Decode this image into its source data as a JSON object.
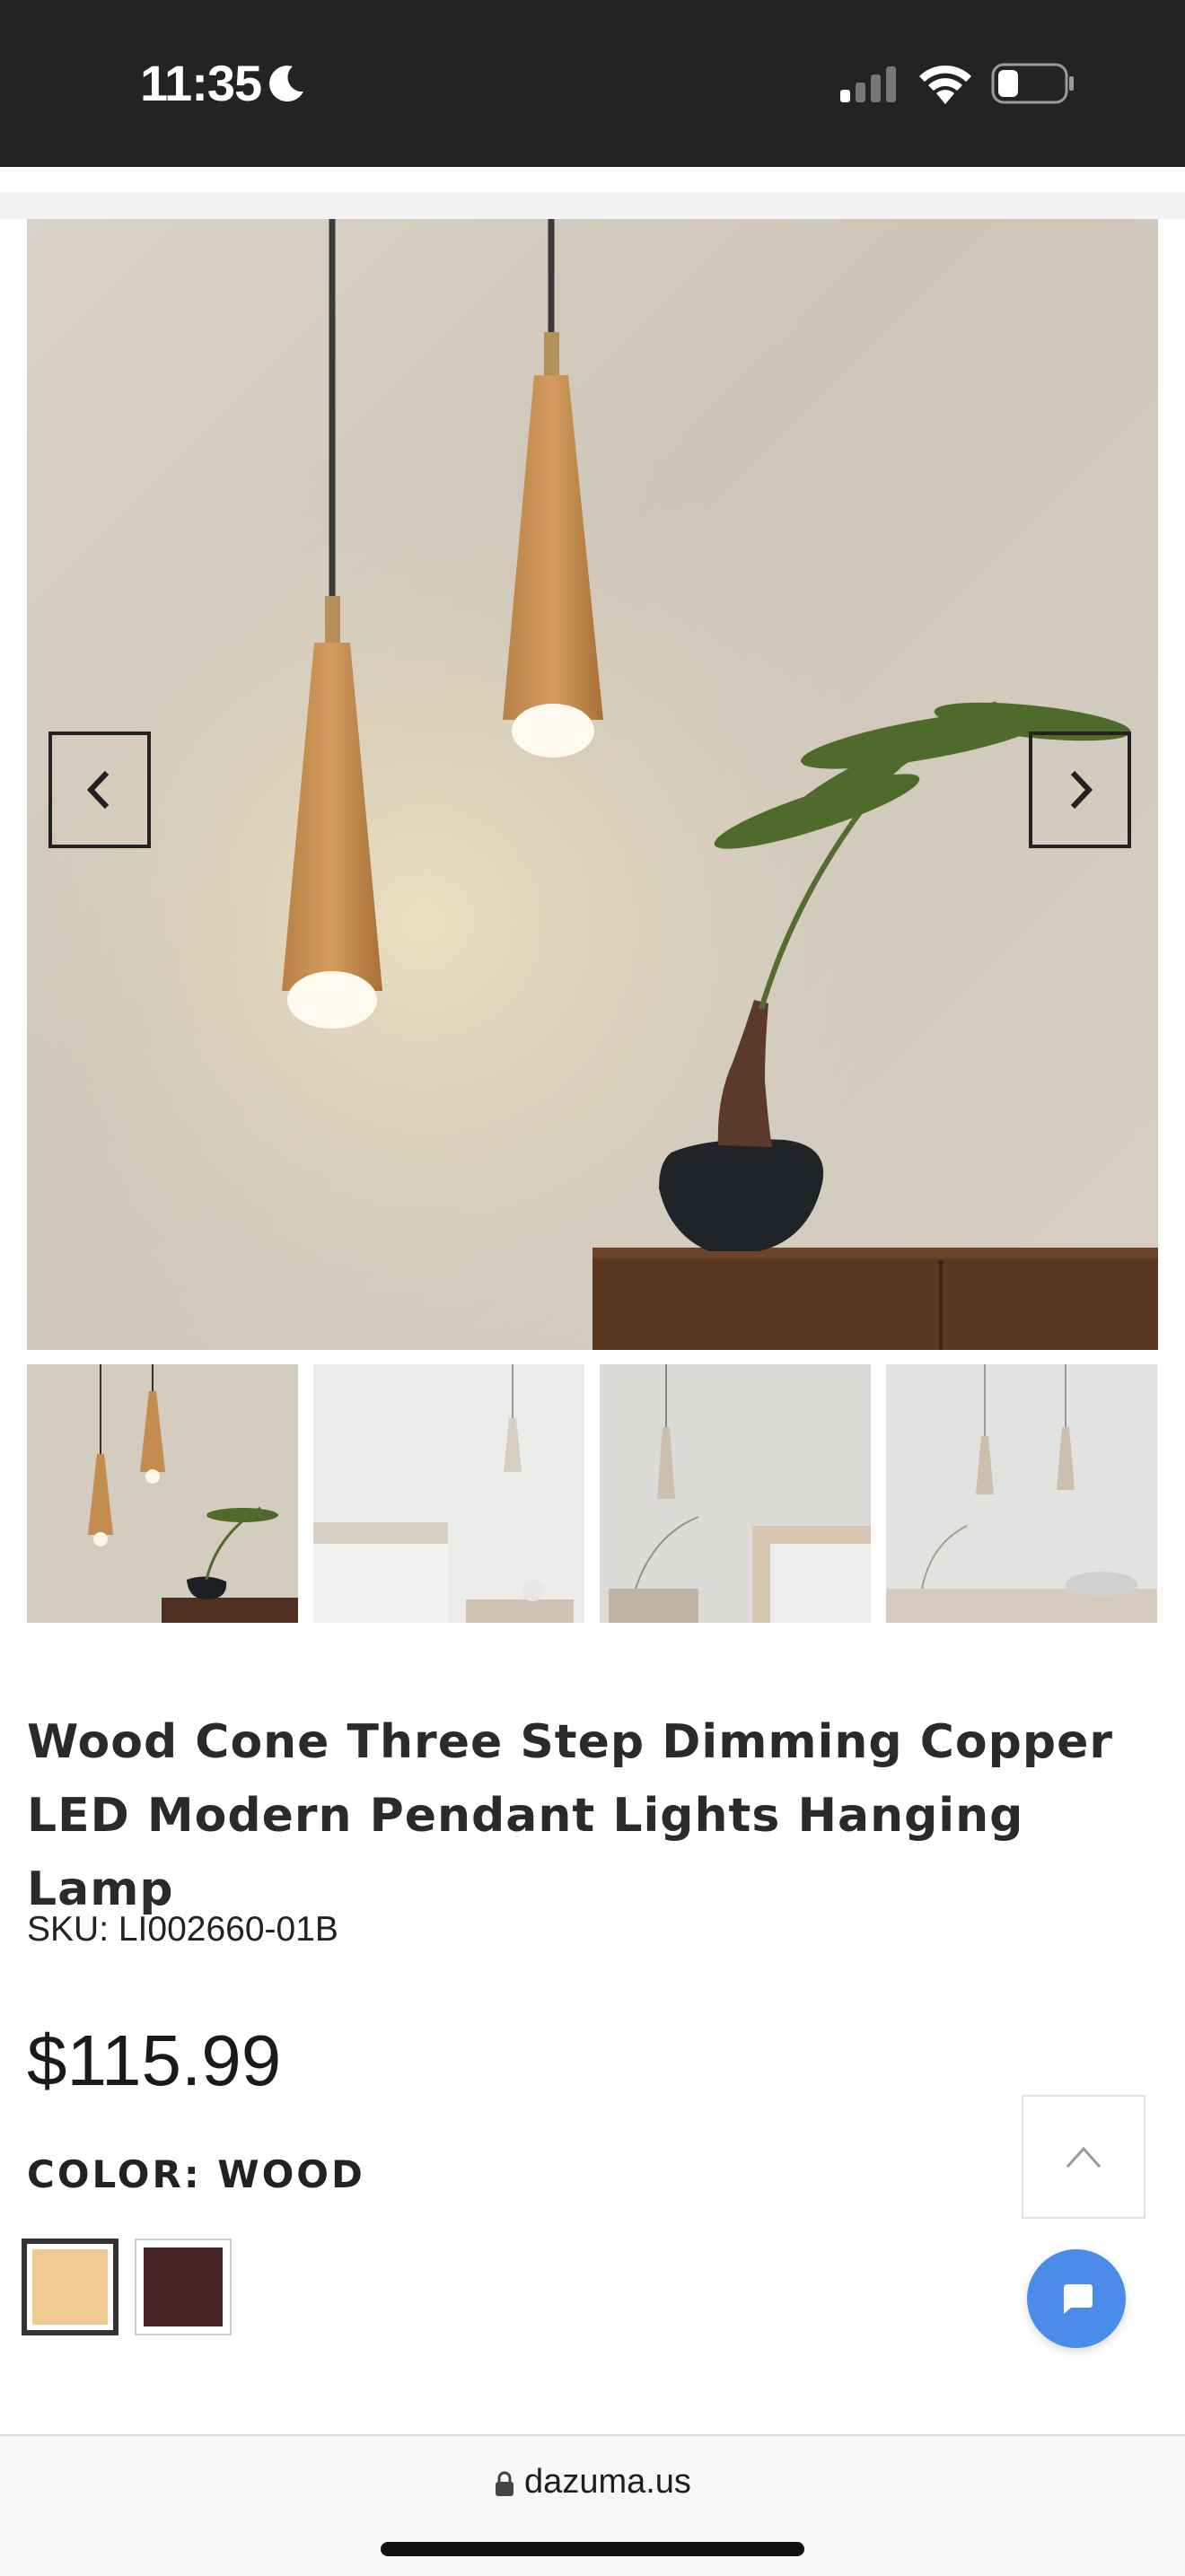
{
  "status_bar": {
    "time": "11:35",
    "moon_icon": "moon-icon",
    "signal_icon": "cellular-signal-icon",
    "wifi_icon": "wifi-icon",
    "battery_icon": "battery-icon"
  },
  "gallery": {
    "prev_icon": "chevron-left-icon",
    "next_icon": "chevron-right-icon",
    "thumbnail_count": 4
  },
  "product": {
    "title": "Wood Cone Three Step Dimming Copper LED Modern Pendant Lights Hanging Lamp",
    "sku": "SKU: LI002660-01B",
    "price": "$115.99",
    "color_label": "COLOR: WOOD",
    "swatches": [
      {
        "name": "wood",
        "color": "#f1c993",
        "selected": true
      },
      {
        "name": "dark-brown",
        "color": "#4a2525",
        "selected": false
      }
    ]
  },
  "floating": {
    "back_to_top_icon": "chevron-up-icon",
    "chat_icon": "chat-icon",
    "chat_color": "#4a8ce8"
  },
  "browser": {
    "url": "dazuma.us",
    "lock_icon": "lock-icon"
  }
}
